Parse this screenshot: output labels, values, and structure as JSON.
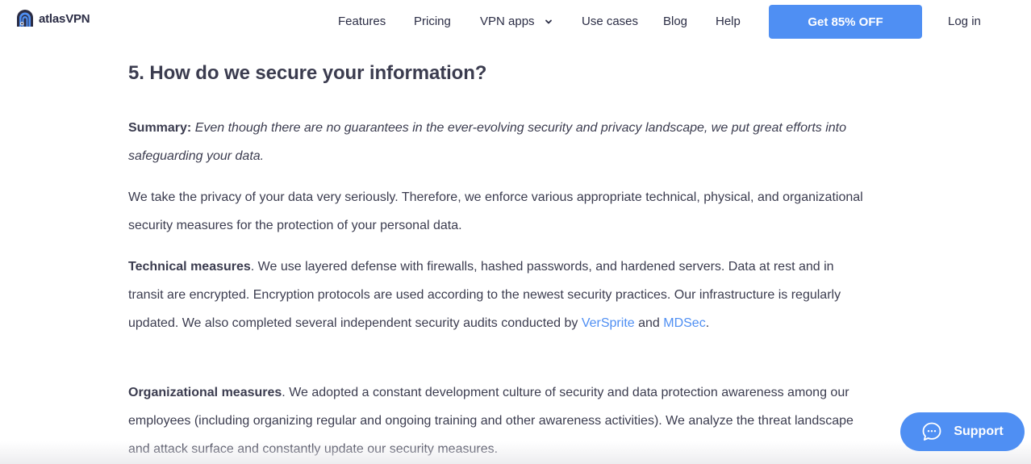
{
  "header": {
    "logo_text": "atlasVPN",
    "nav": [
      {
        "label": "Features"
      },
      {
        "label": "Pricing"
      },
      {
        "label": "VPN apps",
        "has_dropdown": true
      },
      {
        "label": "Use cases"
      },
      {
        "label": "Blog"
      },
      {
        "label": "Help"
      }
    ],
    "cta_label": "Get 85% OFF",
    "login_label": "Log in"
  },
  "article": {
    "heading": "5. How do we secure your information?",
    "summary": {
      "label": "Summary:",
      "text": " Even though there are no guarantees in the ever-evolving security and privacy landscape, we put great efforts into safeguarding your data."
    },
    "intro": "We take the privacy of your data very seriously. Therefore, we enforce various appropriate technical, physical, and organizational security measures for the protection of your personal data.",
    "technical": {
      "label": "Technical measures",
      "text": ". We use layered defense with firewalls, hashed passwords, and hardened servers. Data at rest and in transit are encrypted. Encryption protocols are used according to the newest security practices. Our infrastructure is regularly updated. We also completed several independent security audits conducted by ",
      "link1": "VerSprite",
      "connector": " and ",
      "link2": "MDSec",
      "end": "."
    },
    "organizational": {
      "label": "Organizational measures",
      "text": ". We adopted a constant development culture of security and data protection awareness among our employees (including organizing regular and ongoing training and other awareness activities). We analyze the threat landscape and attack surface and constantly update our security measures."
    }
  },
  "support_button": {
    "label": "Support",
    "icon": "chat-bubble-icon"
  },
  "colors": {
    "accent": "#4f8ff3",
    "text": "#3b3c4f",
    "nav_text": "#2b2d45"
  }
}
